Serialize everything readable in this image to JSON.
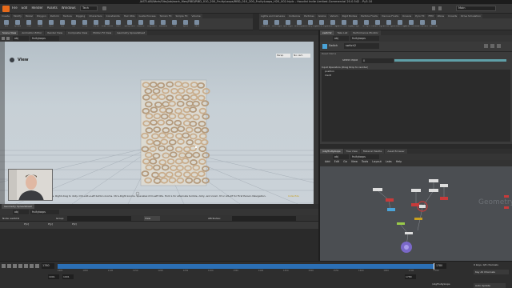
{
  "window": {
    "title": "/ASTLAB/Work/Site/job/work_files/RBD/RBD_010_200_FruityLoops/RBD_010_200_FruityLoops_H20_002.hiplc - Houdini Indie Limited-Commercial 20.0.542 - Py3.10"
  },
  "menu": [
    "File",
    "Edit",
    "Render",
    "Assets",
    "Windows",
    "Help"
  ],
  "toolbar": {
    "desktop": "Tech",
    "build_label": "Main"
  },
  "shelf": {
    "tabs": [
      "Create",
      "Modify",
      "Model",
      "Polygon",
      "Deform",
      "Texture",
      "Rigging",
      "Characters",
      "Constraints",
      "Hair Utils",
      "Guide Process",
      "Terrain FX",
      "Simple FX",
      "Volume"
    ],
    "tools": [
      "Box",
      "Sphere",
      "Tube",
      "Torus",
      "Grid",
      "Null",
      "Line",
      "Circle",
      "Curve",
      "Draw Curve",
      "Path",
      "Spray Paint",
      "Platonic",
      "L-System",
      "Metaball",
      "File",
      "Spiral",
      "Helix"
    ]
  },
  "shelf_right": {
    "tabs": [
      "Lights and Cameras",
      "Collisions",
      "Particles",
      "Grains",
      "Vellum",
      "Rigid Bodies",
      "Particle Fluids",
      "Viscous Fluids",
      "Oceans",
      "Pyro FX",
      "FEM",
      "Wires",
      "Crowds",
      "Drive Simulation"
    ],
    "tools": [
      "Camera",
      "Point Light",
      "Spot Light",
      "Area Light",
      "Geometry Light",
      "Volume Light",
      "Distant Light",
      "Environment Light",
      "Sky Light",
      "GI Light",
      "Caustic Light",
      "Portal Light",
      "Ambient Light",
      "Stereo Camera",
      "VR Camera",
      "Switcher"
    ]
  },
  "scene_view": {
    "tabs": [
      "Scene View",
      "Animation Editor",
      "Render View",
      "Composite View",
      "Motion FX View",
      "Geometry Spreadsheet"
    ],
    "path": [
      "obj",
      "fruityloops"
    ],
    "label": "View",
    "persp": "Persp",
    "cam": "No cam",
    "hint": "pans. Right-drag to dolly. Ctrl+Alt+Left button zooms. Ctrl+Right zooms. Spacebar-Ctrl-Left tilts. Hold L for alternate tumble, dolly, and zoom. M or Alt+M for First Person Navigation.",
    "corner_label": "Indie Edu"
  },
  "spreadsheet": {
    "tab": "Geometry Spreadsheet",
    "path": [
      "obj",
      "fruityloops"
    ],
    "node": "Node: switch2",
    "group_label": "Group:",
    "view_label": "View",
    "attributes_label": "Attributes:",
    "columns": [
      "",
      "P[x]",
      "P[y]",
      "P[z]"
    ]
  },
  "timeline": {
    "frame": "1780",
    "start": "1001",
    "end": "1001",
    "range_end": "1780",
    "range_end2": "1780",
    "keys": "0 keys, 0/0 channels",
    "keys_btn": "Key All Channels",
    "status_path": "/obj/fruityloops",
    "auto_update": "Auto Update",
    "ticks": [
      "1001",
      "1050",
      "1100",
      "1150",
      "1200",
      "1250",
      "1300",
      "1350",
      "1400",
      "1450",
      "1500",
      "1550",
      "1600",
      "1650",
      "1700",
      "1780"
    ]
  },
  "parameters": {
    "tabs": [
      "switch2",
      "Take List",
      "Performance Monitor"
    ],
    "path": [
      "obj",
      "fruityloops"
    ],
    "node_type": "Switch",
    "node_name": "switch2",
    "reset_label": "Reset Name",
    "select_input_label": "Select Input",
    "select_input_value": "0",
    "inputs_header": "Input Operators (Drag Drop to reorder)",
    "inputs": [
      "position",
      "merit"
    ]
  },
  "network": {
    "tabs": [
      "/obj/fruityloops",
      "Tree View",
      "Material Palette",
      "Asset Browser"
    ],
    "path": [
      "obj",
      "fruityloops"
    ],
    "menu": [
      "Add",
      "Edit",
      "Go",
      "View",
      "Tools",
      "Layout",
      "Labs",
      "Help"
    ],
    "watermark": "Geometry"
  },
  "colors": {
    "accent": "#e86a1a",
    "timeline_bar": "#2b6fb5",
    "node_red": "#c83a3a",
    "node_purple": "#7a68c8"
  }
}
